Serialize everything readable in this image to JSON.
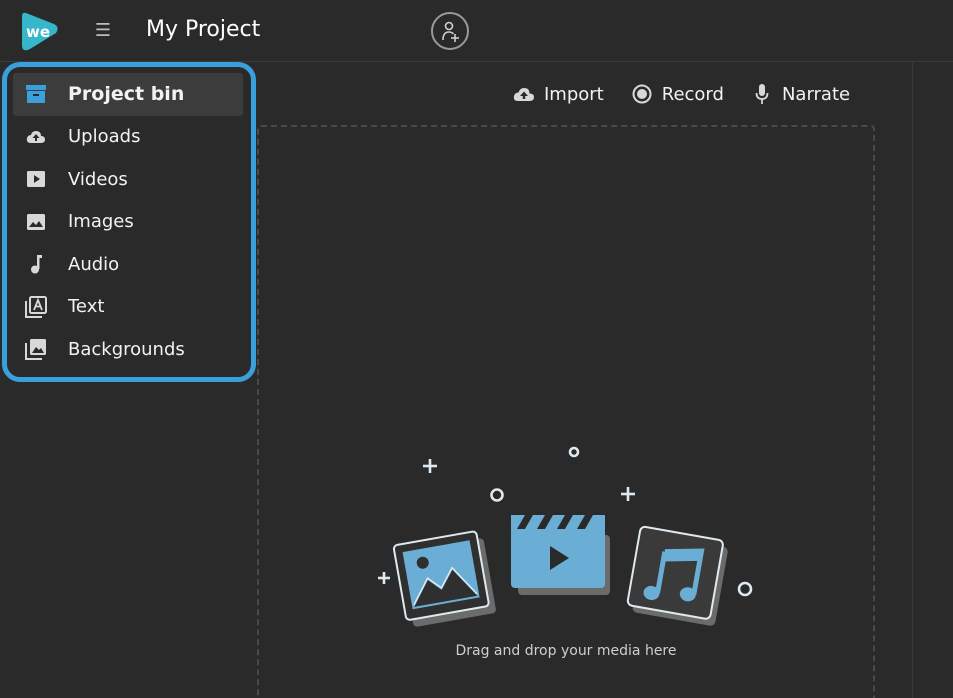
{
  "header": {
    "logo_text": "we",
    "menu_icon": "hamburger-icon",
    "project_title": "My Project",
    "add_user_icon": "add-user-icon"
  },
  "sidebar": {
    "items": [
      {
        "label": "Project bin",
        "icon": "archive-icon",
        "active": true
      },
      {
        "label": "Uploads",
        "icon": "cloud-upload-icon",
        "active": false
      },
      {
        "label": "Videos",
        "icon": "play-box-icon",
        "active": false
      },
      {
        "label": "Images",
        "icon": "image-icon",
        "active": false
      },
      {
        "label": "Audio",
        "icon": "music-note-icon",
        "active": false
      },
      {
        "label": "Text",
        "icon": "text-box-icon",
        "active": false
      },
      {
        "label": "Backgrounds",
        "icon": "backgrounds-icon",
        "active": false
      }
    ]
  },
  "toolbar": {
    "import_label": "Import",
    "record_label": "Record",
    "narrate_label": "Narrate"
  },
  "dropzone": {
    "text": "Drag and drop your media here"
  },
  "colors": {
    "accent": "#3aa0dc",
    "illustration_blue": "#6aaed6",
    "background": "#2a2a2a"
  }
}
